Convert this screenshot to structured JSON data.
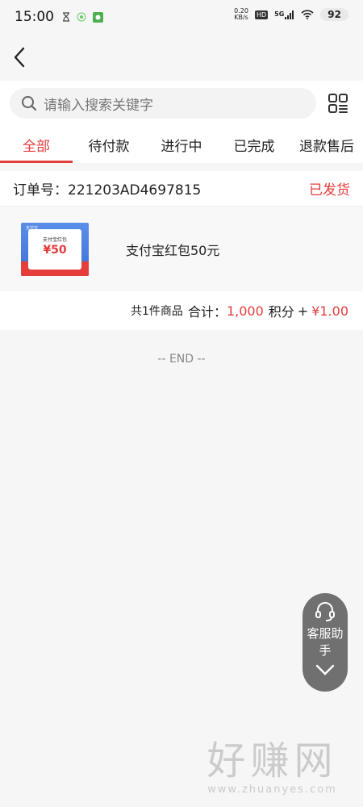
{
  "status_bar": {
    "time": "15:00",
    "network_speed_value": "0.20",
    "network_speed_unit": "KB/s",
    "hd_label": "HD",
    "signal_label": "5G",
    "battery": "92"
  },
  "search": {
    "placeholder": "请输入搜索关键字"
  },
  "tabs": [
    {
      "label": "全部",
      "active": true
    },
    {
      "label": "待付款",
      "active": false
    },
    {
      "label": "进行中",
      "active": false
    },
    {
      "label": "已完成",
      "active": false
    },
    {
      "label": "退款售后",
      "active": false
    }
  ],
  "order": {
    "number_label": "订单号：",
    "number": "221203AD4697815",
    "status": "已发货",
    "item": {
      "name": "支付宝红包50元",
      "thumb_title": "支付宝红包",
      "thumb_amount": "¥50",
      "thumb_brand": "支付宝"
    },
    "summary": {
      "count_text": "共1件商品",
      "total_label": "合计：",
      "points": "1,000",
      "points_unit": "积分",
      "plus": "+",
      "price": "¥1.00"
    }
  },
  "end_text": "-- END --",
  "assistant": {
    "label": "客服助手"
  },
  "watermark": {
    "title": "好赚网",
    "url": "www.zhuanyes.com"
  },
  "colors": {
    "accent": "#e53c3c",
    "background": "#f6f6f6"
  }
}
